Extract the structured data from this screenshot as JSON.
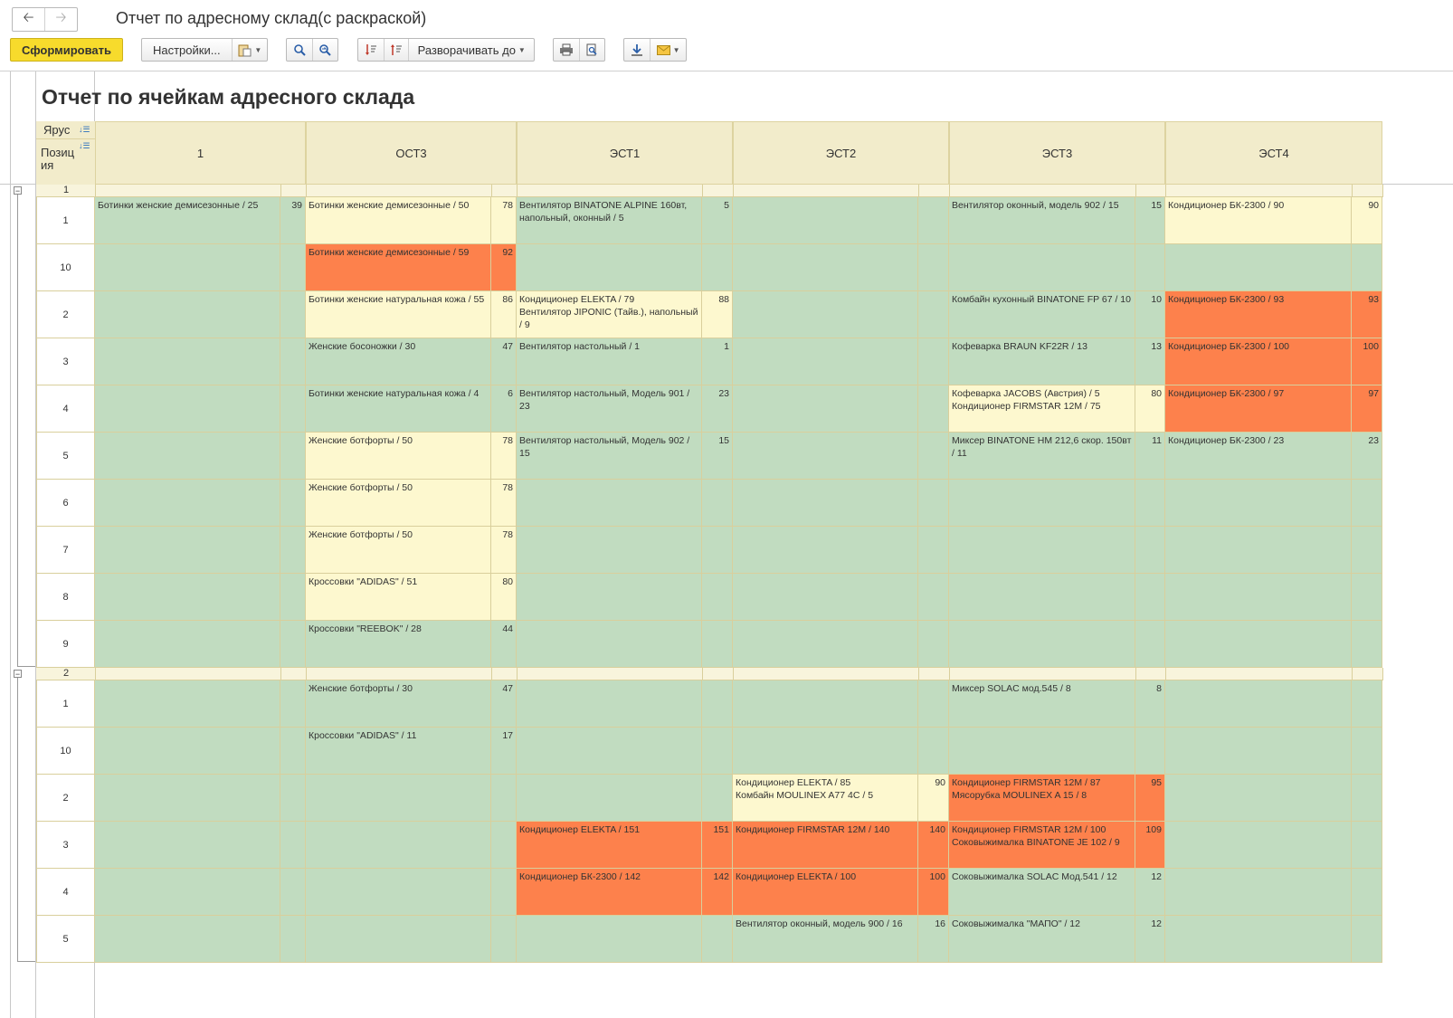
{
  "window": {
    "title": "Отчет по адресному склад(с раскраской)"
  },
  "toolbar": {
    "generate_label": "Сформировать",
    "settings_label": "Настройки...",
    "expand_label": "Разворачивать до"
  },
  "report": {
    "title": "Отчет по ячейкам адресного склада",
    "row_header_tier": "Ярус",
    "row_header_position": "Позиция",
    "columns": [
      "1",
      "ОСТ3",
      "ЭСТ1",
      "ЭСТ2",
      "ЭСТ3",
      "ЭСТ4"
    ],
    "colors": {
      "green": "#c1dcc0",
      "yellow": "#fdf8cf",
      "orange": "#fd814c",
      "header": "#f2eccb"
    },
    "groups": [
      {
        "tier": "1",
        "rows": [
          {
            "pos": "1",
            "cells": [
              {
                "c": "g",
                "text": "Ботинки женские демисезонные / 25",
                "qty": "39"
              },
              {
                "c": "y",
                "text": "Ботинки женские демисезонные / 50",
                "qty": "78"
              },
              {
                "c": "g",
                "text": "Вентилятор BINATONE ALPINE 160вт, напольный, оконный / 5",
                "qty": "5"
              },
              {
                "c": "g",
                "text": "",
                "qty": ""
              },
              {
                "c": "g",
                "text": "Вентилятор оконный, модель 902 / 15",
                "qty": "15"
              },
              {
                "c": "y",
                "text": "Кондиционер БК-2300 / 90",
                "qty": "90"
              }
            ]
          },
          {
            "pos": "10",
            "cells": [
              {
                "c": "g",
                "text": "",
                "qty": ""
              },
              {
                "c": "o",
                "text": "Ботинки женские демисезонные / 59",
                "qty": "92"
              },
              {
                "c": "g",
                "text": "",
                "qty": ""
              },
              {
                "c": "g",
                "text": "",
                "qty": ""
              },
              {
                "c": "g",
                "text": "",
                "qty": ""
              },
              {
                "c": "g",
                "text": "",
                "qty": ""
              }
            ]
          },
          {
            "pos": "2",
            "cells": [
              {
                "c": "g",
                "text": "",
                "qty": ""
              },
              {
                "c": "y",
                "text": "Ботинки женские натуральная кожа / 55",
                "qty": "86"
              },
              {
                "c": "y",
                "text": "Кондиционер ELEKTA / 79\nВентилятор JIPONIC (Тайв.), напольный / 9",
                "qty": "88"
              },
              {
                "c": "g",
                "text": "",
                "qty": ""
              },
              {
                "c": "g",
                "text": "Комбайн кухонный BINATONE FP 67 / 10",
                "qty": "10"
              },
              {
                "c": "o",
                "text": "Кондиционер БК-2300 / 93",
                "qty": "93"
              }
            ]
          },
          {
            "pos": "3",
            "cells": [
              {
                "c": "g",
                "text": "",
                "qty": ""
              },
              {
                "c": "g",
                "text": "Женские босоножки / 30",
                "qty": "47"
              },
              {
                "c": "g",
                "text": "Вентилятор настольный / 1",
                "qty": "1"
              },
              {
                "c": "g",
                "text": "",
                "qty": ""
              },
              {
                "c": "g",
                "text": "Кофеварка BRAUN KF22R / 13",
                "qty": "13"
              },
              {
                "c": "o",
                "text": "Кондиционер БК-2300 / 100",
                "qty": "100"
              }
            ]
          },
          {
            "pos": "4",
            "cells": [
              {
                "c": "g",
                "text": "",
                "qty": ""
              },
              {
                "c": "g",
                "text": "Ботинки женские натуральная кожа / 4",
                "qty": "6"
              },
              {
                "c": "g",
                "text": "Вентилятор настольный, Модель 901 / 23",
                "qty": "23"
              },
              {
                "c": "g",
                "text": "",
                "qty": ""
              },
              {
                "c": "y",
                "text": "Кофеварка JACOBS (Австрия) / 5\nКондиционер FIRMSTAR 12M / 75",
                "qty": "80"
              },
              {
                "c": "o",
                "text": "Кондиционер БК-2300 / 97",
                "qty": "97"
              }
            ]
          },
          {
            "pos": "5",
            "cells": [
              {
                "c": "g",
                "text": "",
                "qty": ""
              },
              {
                "c": "y",
                "text": "Женские ботфорты / 50",
                "qty": "78"
              },
              {
                "c": "g",
                "text": "Вентилятор настольный, Модель 902 / 15",
                "qty": "15"
              },
              {
                "c": "g",
                "text": "",
                "qty": ""
              },
              {
                "c": "g",
                "text": "Миксер BINATONE HM 212,6 скор. 150вт / 11",
                "qty": "11"
              },
              {
                "c": "g",
                "text": "Кондиционер БК-2300 / 23",
                "qty": "23"
              }
            ]
          },
          {
            "pos": "6",
            "cells": [
              {
                "c": "g",
                "text": "",
                "qty": ""
              },
              {
                "c": "y",
                "text": "Женские ботфорты / 50",
                "qty": "78"
              },
              {
                "c": "g",
                "text": "",
                "qty": ""
              },
              {
                "c": "g",
                "text": "",
                "qty": ""
              },
              {
                "c": "g",
                "text": "",
                "qty": ""
              },
              {
                "c": "g",
                "text": "",
                "qty": ""
              }
            ]
          },
          {
            "pos": "7",
            "cells": [
              {
                "c": "g",
                "text": "",
                "qty": ""
              },
              {
                "c": "y",
                "text": "Женские ботфорты / 50",
                "qty": "78"
              },
              {
                "c": "g",
                "text": "",
                "qty": ""
              },
              {
                "c": "g",
                "text": "",
                "qty": ""
              },
              {
                "c": "g",
                "text": "",
                "qty": ""
              },
              {
                "c": "g",
                "text": "",
                "qty": ""
              }
            ]
          },
          {
            "pos": "8",
            "cells": [
              {
                "c": "g",
                "text": "",
                "qty": ""
              },
              {
                "c": "y",
                "text": "Кроссовки \"ADIDAS\" / 51",
                "qty": "80"
              },
              {
                "c": "g",
                "text": "",
                "qty": ""
              },
              {
                "c": "g",
                "text": "",
                "qty": ""
              },
              {
                "c": "g",
                "text": "",
                "qty": ""
              },
              {
                "c": "g",
                "text": "",
                "qty": ""
              }
            ]
          },
          {
            "pos": "9",
            "cells": [
              {
                "c": "g",
                "text": "",
                "qty": ""
              },
              {
                "c": "g",
                "text": "Кроссовки \"REEBOK\" / 28",
                "qty": "44"
              },
              {
                "c": "g",
                "text": "",
                "qty": ""
              },
              {
                "c": "g",
                "text": "",
                "qty": ""
              },
              {
                "c": "g",
                "text": "",
                "qty": ""
              },
              {
                "c": "g",
                "text": "",
                "qty": ""
              }
            ]
          }
        ]
      },
      {
        "tier": "2",
        "rows": [
          {
            "pos": "1",
            "cells": [
              {
                "c": "g",
                "text": "",
                "qty": ""
              },
              {
                "c": "g",
                "text": "Женские ботфорты / 30",
                "qty": "47"
              },
              {
                "c": "g",
                "text": "",
                "qty": ""
              },
              {
                "c": "g",
                "text": "",
                "qty": ""
              },
              {
                "c": "g",
                "text": "Миксер SOLAC мод.545 / 8",
                "qty": "8"
              },
              {
                "c": "g",
                "text": "",
                "qty": ""
              }
            ]
          },
          {
            "pos": "10",
            "cells": [
              {
                "c": "g",
                "text": "",
                "qty": ""
              },
              {
                "c": "g",
                "text": "Кроссовки \"ADIDAS\" / 11",
                "qty": "17"
              },
              {
                "c": "g",
                "text": "",
                "qty": ""
              },
              {
                "c": "g",
                "text": "",
                "qty": ""
              },
              {
                "c": "g",
                "text": "",
                "qty": ""
              },
              {
                "c": "g",
                "text": "",
                "qty": ""
              }
            ]
          },
          {
            "pos": "2",
            "cells": [
              {
                "c": "g",
                "text": "",
                "qty": ""
              },
              {
                "c": "g",
                "text": "",
                "qty": ""
              },
              {
                "c": "g",
                "text": "",
                "qty": ""
              },
              {
                "c": "y",
                "text": "Кондиционер ELEKTA / 85\nКомбайн MOULINEX  A77 4C / 5",
                "qty": "90"
              },
              {
                "c": "o",
                "text": "Кондиционер FIRMSTAR 12M / 87\nМясорубка MOULINEX  A 15 / 8",
                "qty": "95"
              },
              {
                "c": "g",
                "text": "",
                "qty": ""
              }
            ]
          },
          {
            "pos": "3",
            "cells": [
              {
                "c": "g",
                "text": "",
                "qty": ""
              },
              {
                "c": "g",
                "text": "",
                "qty": ""
              },
              {
                "c": "o",
                "text": "Кондиционер ELEKTA / 151",
                "qty": "151"
              },
              {
                "c": "o",
                "text": "Кондиционер FIRMSTAR 12M / 140",
                "qty": "140"
              },
              {
                "c": "o",
                "text": "Кондиционер FIRMSTAR 12M / 100\nСоковыжималка  BINATONE JE 102 / 9",
                "qty": "109"
              },
              {
                "c": "g",
                "text": "",
                "qty": ""
              }
            ]
          },
          {
            "pos": "4",
            "cells": [
              {
                "c": "g",
                "text": "",
                "qty": ""
              },
              {
                "c": "g",
                "text": "",
                "qty": ""
              },
              {
                "c": "o",
                "text": "Кондиционер БК-2300 / 142",
                "qty": "142"
              },
              {
                "c": "o",
                "text": "Кондиционер ELEKTA / 100",
                "qty": "100"
              },
              {
                "c": "g",
                "text": "Соковыжималка  SOLAC  Мод.541 / 12",
                "qty": "12"
              },
              {
                "c": "g",
                "text": "",
                "qty": ""
              }
            ]
          },
          {
            "pos": "5",
            "cells": [
              {
                "c": "g",
                "text": "",
                "qty": ""
              },
              {
                "c": "g",
                "text": "",
                "qty": ""
              },
              {
                "c": "g",
                "text": "",
                "qty": ""
              },
              {
                "c": "g",
                "text": "Вентилятор оконный, модель 900 / 16",
                "qty": "16"
              },
              {
                "c": "g",
                "text": "Соковыжималка \"МАПО\" / 12",
                "qty": "12"
              },
              {
                "c": "g",
                "text": "",
                "qty": ""
              }
            ]
          }
        ]
      }
    ]
  }
}
